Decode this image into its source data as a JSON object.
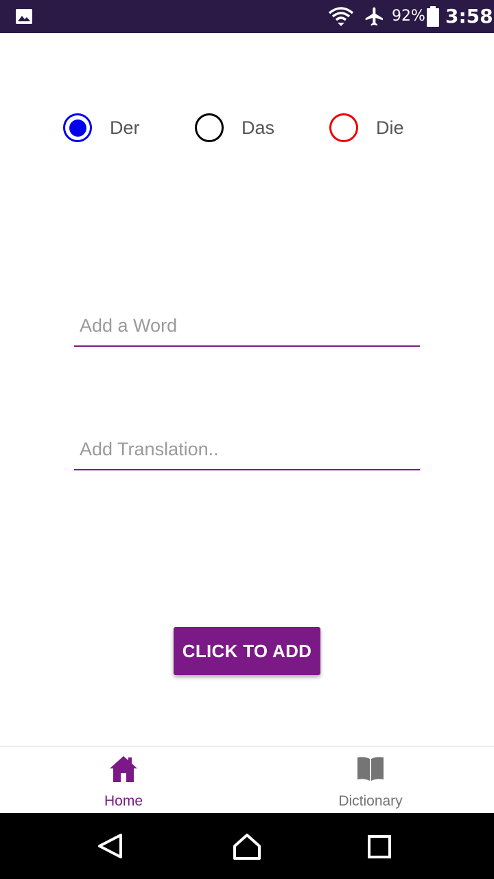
{
  "status_bar": {
    "battery_percent": "92%",
    "time": "3:58",
    "background_color": "#2a1a45",
    "icons": [
      "image-icon",
      "wifi-icon",
      "airplane-mode-icon",
      "battery-icon"
    ]
  },
  "article_selector": {
    "options": [
      {
        "label": "Der",
        "color": "#0000ee",
        "selected": true
      },
      {
        "label": "Das",
        "color": "#000000",
        "selected": false
      },
      {
        "label": "Die",
        "color": "#ee0000",
        "selected": false
      }
    ]
  },
  "word_input": {
    "placeholder": "Add a Word",
    "value": ""
  },
  "translation_input": {
    "placeholder": "Add Translation..",
    "value": ""
  },
  "add_button": {
    "label": "CLICK TO ADD",
    "color": "#7b1a87"
  },
  "bottom_nav": {
    "accent_color": "#7b1a87",
    "items": [
      {
        "label": "Home",
        "icon": "home-icon",
        "active": true
      },
      {
        "label": "Dictionary",
        "icon": "book-icon",
        "active": false
      }
    ]
  },
  "system_nav": {
    "buttons": [
      "back-icon",
      "home-circle-icon",
      "recent-apps-icon"
    ]
  }
}
